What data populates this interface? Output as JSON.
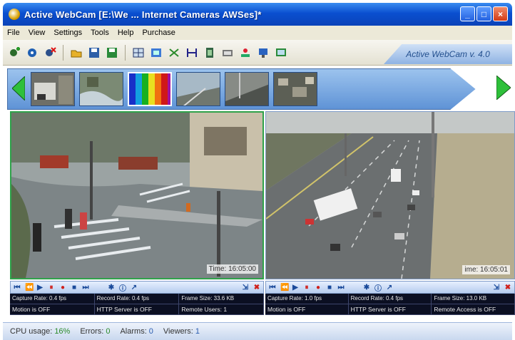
{
  "window": {
    "title": "Active WebCam [E:\\We ... Internet Cameras AWSes]*",
    "buttons": {
      "minimize": "_",
      "maximize": "□",
      "close": "×"
    }
  },
  "menu": [
    "File",
    "View",
    "Settings",
    "Tools",
    "Help",
    "Purchase"
  ],
  "toolbar": {
    "icons": [
      "add-camera-icon",
      "camera-settings-icon",
      "delete-camera-icon",
      "open-icon",
      "save-icon",
      "save-as-icon",
      "layout-icon",
      "fullscreen-icon",
      "motion-icon",
      "zoom-icon",
      "film-icon",
      "settings-icon",
      "network-icon",
      "snapshot-icon",
      "monitor-icon"
    ],
    "version_label": "Active WebCam v. 4.0"
  },
  "thumbnails": [
    "street-camera",
    "river-camera",
    "test-pattern",
    "traffic-highway",
    "traffic-road",
    "aerial-camera"
  ],
  "cameras": [
    {
      "time": "Time: 16:05:00",
      "controls": [
        "⏮",
        "⏪",
        "▶",
        "⏸",
        "●",
        "■",
        "⏭",
        "⏩",
        "✱",
        "ⓘ",
        "↗",
        "⇲",
        "✖"
      ],
      "info": {
        "capture_rate": "Capture Rate: 0.4 fps",
        "record_rate": "Record Rate: 0.4 fps",
        "frame_size": "Frame Size: 33.6 KB",
        "motion": "Motion is OFF",
        "http": "HTTP Server is OFF",
        "remote": "Remote Users: 1"
      }
    },
    {
      "time": "ime: 16:05:01",
      "controls": [
        "⏮",
        "⏪",
        "▶",
        "⏸",
        "●",
        "■",
        "⏭",
        "⏩",
        "✱",
        "ⓘ",
        "↗",
        "⇲",
        "✖"
      ],
      "info": {
        "capture_rate": "Capture Rate: 1.0 fps",
        "record_rate": "Record Rate: 0.4 fps",
        "frame_size": "Frame Size: 13.0 KB",
        "motion": "Motion is OFF",
        "http": "HTTP Server is OFF",
        "remote": "Remote Access is OFF"
      }
    }
  ],
  "status": {
    "cpu_label": "CPU usage:",
    "cpu_value": "16%",
    "errors_label": "Errors:",
    "errors_value": "0",
    "alarms_label": "Alarms:",
    "alarms_value": "0",
    "viewers_label": "Viewers:",
    "viewers_value": "1"
  },
  "colors": {
    "title_blue": "#0a4fd0",
    "thumbstrip_blue": "#5f93d6",
    "active_border": "#2fa24a",
    "info_bg": "#0b0f22",
    "status_green": "#2a8a2a"
  }
}
